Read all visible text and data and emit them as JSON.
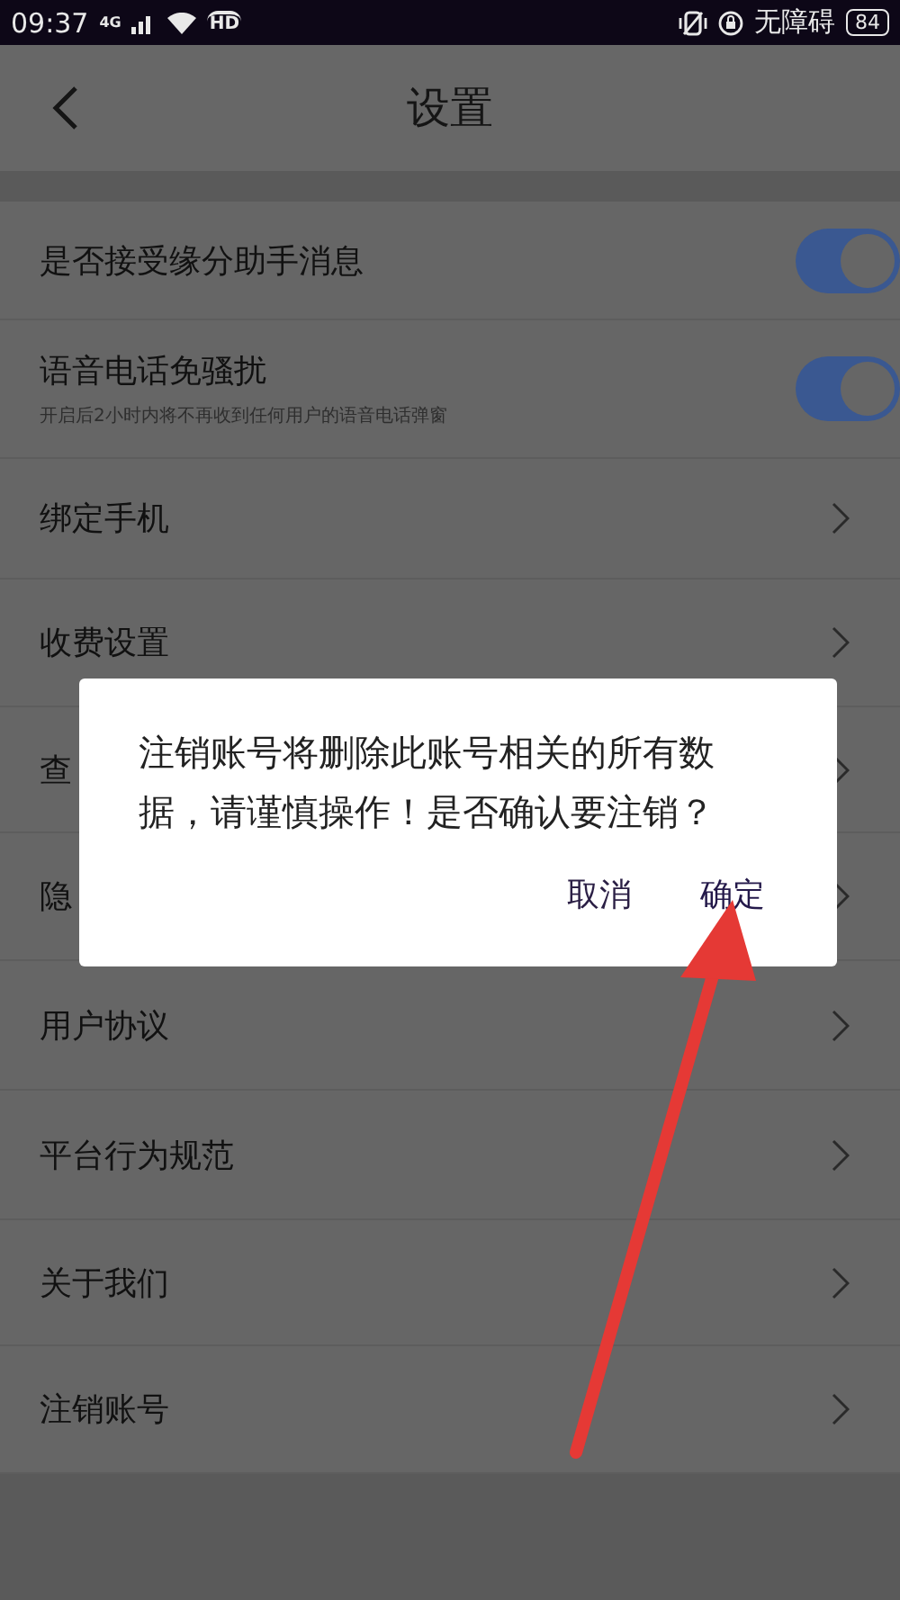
{
  "status_bar": {
    "time": "09:37",
    "network": "4G",
    "hd": "HD",
    "accessibility": "无障碍",
    "battery": "84"
  },
  "header": {
    "title": "设置"
  },
  "settings": [
    {
      "kind": "toggle",
      "label": "是否接受缘分助手消息",
      "on": true
    },
    {
      "kind": "toggle",
      "label": "语音电话免骚扰",
      "subtitle": "开启后2小时内将不再收到任何用户的语音电话弹窗",
      "on": true
    },
    {
      "kind": "link",
      "label": "绑定手机"
    },
    {
      "kind": "link",
      "label": "收费设置"
    },
    {
      "kind": "link",
      "label": "查"
    },
    {
      "kind": "link",
      "label": "隐"
    },
    {
      "kind": "link",
      "label": "用户协议"
    },
    {
      "kind": "link",
      "label": "平台行为规范"
    },
    {
      "kind": "link",
      "label": "关于我们"
    },
    {
      "kind": "link",
      "label": "注销账号"
    }
  ],
  "dialog": {
    "message": "注销账号将删除此账号相关的所有数据，请谨慎操作！是否确认要注销？",
    "buttons": [
      {
        "label": "取消",
        "kind": "cancel"
      },
      {
        "label": "确定",
        "kind": "confirm"
      }
    ]
  }
}
